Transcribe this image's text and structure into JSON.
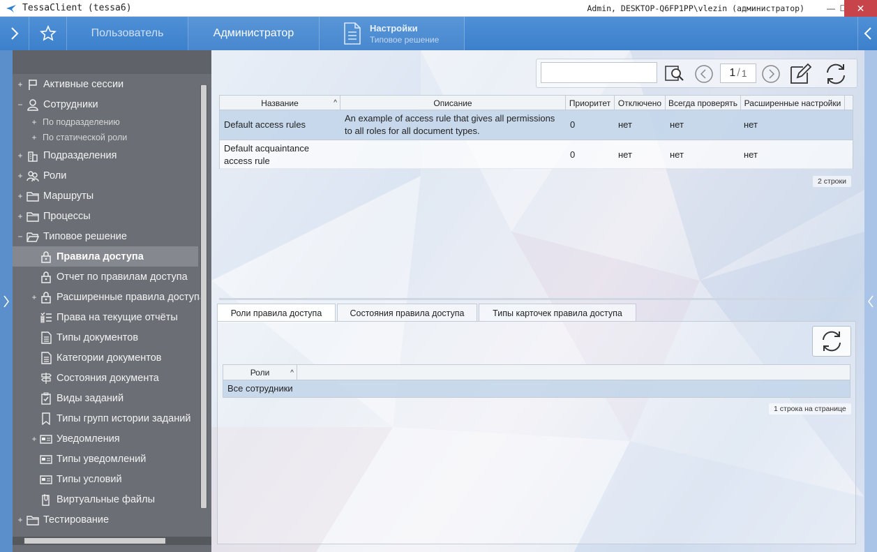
{
  "window": {
    "title": "TessaClient (tessa6)",
    "user": "Admin, DESKTOP-Q6FP1PP\\vlezin (администратор)",
    "minimize": "—",
    "maximize": "☐",
    "close": "✕"
  },
  "ribbon": {
    "tabs": [
      "Пользователь",
      "Администратор"
    ],
    "active_tab": "Администратор",
    "settings_title": "Настройки",
    "settings_subtitle": "Типовое решение"
  },
  "sidebar": {
    "items": [
      {
        "label": "Активные сессии",
        "expander": "+",
        "icon": "flag-icon",
        "level": 0
      },
      {
        "label": "Сотрудники",
        "expander": "−",
        "icon": "person-icon",
        "level": 0
      },
      {
        "label": "По подразделению",
        "expander": "+",
        "icon": "",
        "level": 1
      },
      {
        "label": "По статической роли",
        "expander": "+",
        "icon": "",
        "level": 1
      },
      {
        "label": "Подразделения",
        "expander": "+",
        "icon": "building-icon",
        "level": 0
      },
      {
        "label": "Роли",
        "expander": "+",
        "icon": "people-icon",
        "level": 0
      },
      {
        "label": "Маршруты",
        "expander": "+",
        "icon": "folder-icon",
        "level": 0
      },
      {
        "label": "Процессы",
        "expander": "+",
        "icon": "folder-icon",
        "level": 0
      },
      {
        "label": "Типовое решение",
        "expander": "−",
        "icon": "open-folder-icon",
        "level": 0
      },
      {
        "label": "Правила доступа",
        "expander": "",
        "icon": "lock-icon",
        "level": 2,
        "selected": true
      },
      {
        "label": "Отчет по правилам доступа",
        "expander": "",
        "icon": "lock-icon",
        "level": 2
      },
      {
        "label": "Расширенные правила доступа",
        "expander": "+",
        "icon": "lock-icon",
        "level": 2
      },
      {
        "label": "Права на текущие отчёты",
        "expander": "",
        "icon": "checklist-icon",
        "level": 2
      },
      {
        "label": "Типы документов",
        "expander": "",
        "icon": "document-icon",
        "level": 2
      },
      {
        "label": "Категории документов",
        "expander": "",
        "icon": "document-icon",
        "level": 2
      },
      {
        "label": "Состояния документа",
        "expander": "",
        "icon": "signpost-icon",
        "level": 2
      },
      {
        "label": "Виды заданий",
        "expander": "",
        "icon": "clipboard-check-icon",
        "level": 2
      },
      {
        "label": "Типы групп истории заданий",
        "expander": "",
        "icon": "bookmark-icon",
        "level": 2
      },
      {
        "label": "Уведомления",
        "expander": "+",
        "icon": "notification-icon",
        "level": 2
      },
      {
        "label": "Типы уведомлений",
        "expander": "",
        "icon": "notification-icon",
        "level": 2
      },
      {
        "label": "Типы условий",
        "expander": "",
        "icon": "notification-icon",
        "level": 2
      },
      {
        "label": "Виртуальные файлы",
        "expander": "",
        "icon": "file-clip-icon",
        "level": 2
      },
      {
        "label": "Тестирование",
        "expander": "+",
        "icon": "folder-icon",
        "level": 0
      }
    ]
  },
  "search": {
    "value": "",
    "placeholder": ""
  },
  "pager": {
    "current": "1",
    "separator": "/",
    "total": "1"
  },
  "grid": {
    "columns": [
      "Название",
      "Описание",
      "Приоритет",
      "Отключено",
      "Всегда проверять",
      "Расширенные настройки"
    ],
    "sort_indicator": "^",
    "rows": [
      [
        "Default access rules",
        "An example of access rule that gives all permissions to all roles for all document types.",
        "0",
        "нет",
        "нет",
        "нет"
      ],
      [
        "Default acquaintance access rule",
        "",
        "0",
        "нет",
        "нет",
        "нет"
      ]
    ],
    "count_label": "2 строки"
  },
  "tabs": [
    "Роли правила доступа",
    "Состояния правила доступа",
    "Типы карточек правила доступа"
  ],
  "roles_grid": {
    "columns": [
      "Роли"
    ],
    "sort_indicator": "^",
    "rows": [
      [
        "Все сотрудники"
      ]
    ],
    "count_label": "1 строка на странице"
  },
  "colors": {
    "ribbon": "#4388d2",
    "sidebar": "#6b6f75",
    "selected_row": "#bed2e8"
  }
}
